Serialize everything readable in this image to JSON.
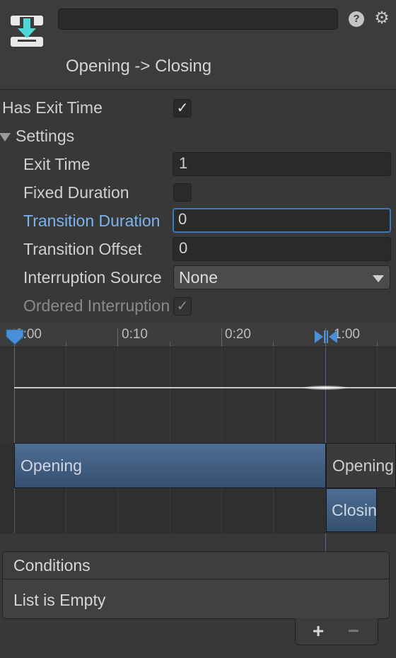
{
  "header": {
    "name_value": "",
    "title": "Opening -> Closing",
    "help_glyph": "?",
    "gear_glyph": "⚙"
  },
  "inspector": {
    "has_exit_time": {
      "label": "Has Exit Time",
      "checked": true
    },
    "settings": {
      "label": "Settings",
      "expanded": true,
      "exit_time": {
        "label": "Exit Time",
        "value": "1"
      },
      "fixed_duration": {
        "label": "Fixed Duration",
        "checked": false
      },
      "transition_duration": {
        "label": "Transition Duration",
        "value": "0",
        "focused": true
      },
      "transition_offset": {
        "label": "Transition Offset",
        "value": "0"
      },
      "interruption_source": {
        "label": "Interruption Source",
        "value": "None"
      },
      "ordered_interruption": {
        "label": "Ordered Interruption",
        "checked": true,
        "disabled": true
      }
    }
  },
  "timeline": {
    "ruler_labels": [
      "0:00",
      "0:10",
      "0:20",
      "1:00"
    ],
    "bars": {
      "source_state": "Opening",
      "source_state_repeat": "Opening",
      "destination_state": "Closing"
    }
  },
  "conditions": {
    "title": "Conditions",
    "empty_text": "List is Empty",
    "add_label": "+",
    "remove_label": "−"
  },
  "colors": {
    "background": "#383838",
    "accent_blue": "#3a79bb",
    "bar_blue": "#46658a",
    "icon_teal": "#4fd6d6"
  }
}
